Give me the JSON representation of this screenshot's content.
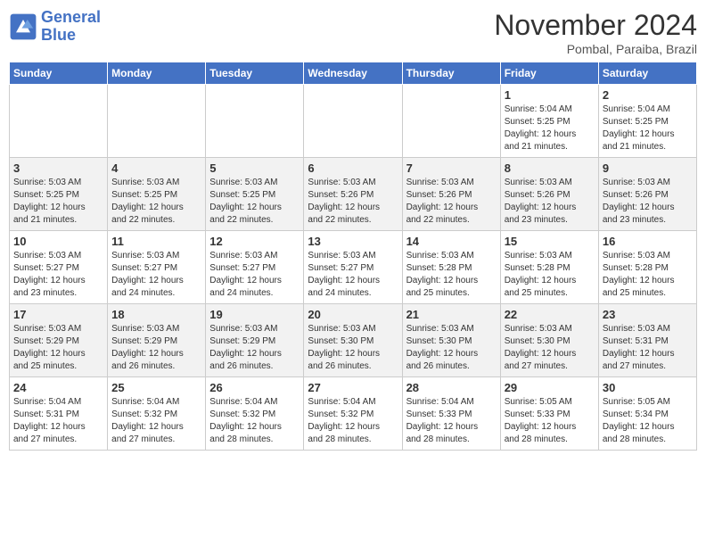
{
  "logo": {
    "line1": "General",
    "line2": "Blue"
  },
  "title": "November 2024",
  "location": "Pombal, Paraiba, Brazil",
  "weekdays": [
    "Sunday",
    "Monday",
    "Tuesday",
    "Wednesday",
    "Thursday",
    "Friday",
    "Saturday"
  ],
  "weeks": [
    [
      {
        "day": "",
        "info": ""
      },
      {
        "day": "",
        "info": ""
      },
      {
        "day": "",
        "info": ""
      },
      {
        "day": "",
        "info": ""
      },
      {
        "day": "",
        "info": ""
      },
      {
        "day": "1",
        "info": "Sunrise: 5:04 AM\nSunset: 5:25 PM\nDaylight: 12 hours\nand 21 minutes."
      },
      {
        "day": "2",
        "info": "Sunrise: 5:04 AM\nSunset: 5:25 PM\nDaylight: 12 hours\nand 21 minutes."
      }
    ],
    [
      {
        "day": "3",
        "info": "Sunrise: 5:03 AM\nSunset: 5:25 PM\nDaylight: 12 hours\nand 21 minutes."
      },
      {
        "day": "4",
        "info": "Sunrise: 5:03 AM\nSunset: 5:25 PM\nDaylight: 12 hours\nand 22 minutes."
      },
      {
        "day": "5",
        "info": "Sunrise: 5:03 AM\nSunset: 5:25 PM\nDaylight: 12 hours\nand 22 minutes."
      },
      {
        "day": "6",
        "info": "Sunrise: 5:03 AM\nSunset: 5:26 PM\nDaylight: 12 hours\nand 22 minutes."
      },
      {
        "day": "7",
        "info": "Sunrise: 5:03 AM\nSunset: 5:26 PM\nDaylight: 12 hours\nand 22 minutes."
      },
      {
        "day": "8",
        "info": "Sunrise: 5:03 AM\nSunset: 5:26 PM\nDaylight: 12 hours\nand 23 minutes."
      },
      {
        "day": "9",
        "info": "Sunrise: 5:03 AM\nSunset: 5:26 PM\nDaylight: 12 hours\nand 23 minutes."
      }
    ],
    [
      {
        "day": "10",
        "info": "Sunrise: 5:03 AM\nSunset: 5:27 PM\nDaylight: 12 hours\nand 23 minutes."
      },
      {
        "day": "11",
        "info": "Sunrise: 5:03 AM\nSunset: 5:27 PM\nDaylight: 12 hours\nand 24 minutes."
      },
      {
        "day": "12",
        "info": "Sunrise: 5:03 AM\nSunset: 5:27 PM\nDaylight: 12 hours\nand 24 minutes."
      },
      {
        "day": "13",
        "info": "Sunrise: 5:03 AM\nSunset: 5:27 PM\nDaylight: 12 hours\nand 24 minutes."
      },
      {
        "day": "14",
        "info": "Sunrise: 5:03 AM\nSunset: 5:28 PM\nDaylight: 12 hours\nand 25 minutes."
      },
      {
        "day": "15",
        "info": "Sunrise: 5:03 AM\nSunset: 5:28 PM\nDaylight: 12 hours\nand 25 minutes."
      },
      {
        "day": "16",
        "info": "Sunrise: 5:03 AM\nSunset: 5:28 PM\nDaylight: 12 hours\nand 25 minutes."
      }
    ],
    [
      {
        "day": "17",
        "info": "Sunrise: 5:03 AM\nSunset: 5:29 PM\nDaylight: 12 hours\nand 25 minutes."
      },
      {
        "day": "18",
        "info": "Sunrise: 5:03 AM\nSunset: 5:29 PM\nDaylight: 12 hours\nand 26 minutes."
      },
      {
        "day": "19",
        "info": "Sunrise: 5:03 AM\nSunset: 5:29 PM\nDaylight: 12 hours\nand 26 minutes."
      },
      {
        "day": "20",
        "info": "Sunrise: 5:03 AM\nSunset: 5:30 PM\nDaylight: 12 hours\nand 26 minutes."
      },
      {
        "day": "21",
        "info": "Sunrise: 5:03 AM\nSunset: 5:30 PM\nDaylight: 12 hours\nand 26 minutes."
      },
      {
        "day": "22",
        "info": "Sunrise: 5:03 AM\nSunset: 5:30 PM\nDaylight: 12 hours\nand 27 minutes."
      },
      {
        "day": "23",
        "info": "Sunrise: 5:03 AM\nSunset: 5:31 PM\nDaylight: 12 hours\nand 27 minutes."
      }
    ],
    [
      {
        "day": "24",
        "info": "Sunrise: 5:04 AM\nSunset: 5:31 PM\nDaylight: 12 hours\nand 27 minutes."
      },
      {
        "day": "25",
        "info": "Sunrise: 5:04 AM\nSunset: 5:32 PM\nDaylight: 12 hours\nand 27 minutes."
      },
      {
        "day": "26",
        "info": "Sunrise: 5:04 AM\nSunset: 5:32 PM\nDaylight: 12 hours\nand 28 minutes."
      },
      {
        "day": "27",
        "info": "Sunrise: 5:04 AM\nSunset: 5:32 PM\nDaylight: 12 hours\nand 28 minutes."
      },
      {
        "day": "28",
        "info": "Sunrise: 5:04 AM\nSunset: 5:33 PM\nDaylight: 12 hours\nand 28 minutes."
      },
      {
        "day": "29",
        "info": "Sunrise: 5:05 AM\nSunset: 5:33 PM\nDaylight: 12 hours\nand 28 minutes."
      },
      {
        "day": "30",
        "info": "Sunrise: 5:05 AM\nSunset: 5:34 PM\nDaylight: 12 hours\nand 28 minutes."
      }
    ]
  ]
}
